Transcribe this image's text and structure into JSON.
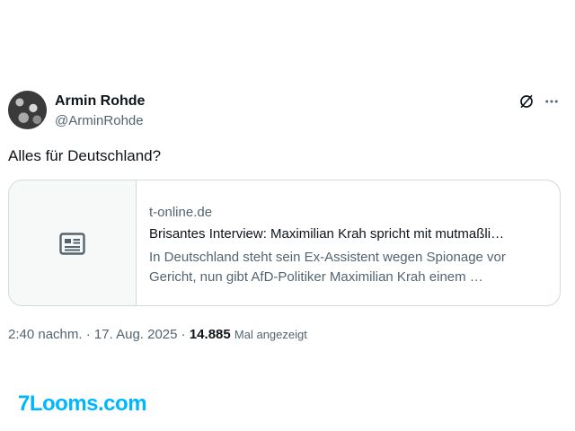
{
  "author": {
    "name": "Armin Rohde",
    "handle": "@ArminRohde"
  },
  "tweet": {
    "text": "Alles für Deutschland?"
  },
  "card": {
    "domain": "t-online.de",
    "title": "Brisantes Interview: Maximilian Krah spricht mit mutmaßli…",
    "description": "In Deutschland steht sein Ex-Assistent wegen Spionage vor Gericht, nun gibt AfD-Politiker Maximilian Krah einem …"
  },
  "meta": {
    "time": "2:40 nachm.",
    "date": "17. Aug. 2025",
    "views": "14.885",
    "views_label": "Mal angezeigt"
  },
  "watermark": "7Looms.com",
  "icons": {
    "grok": "grok-icon",
    "more": "more-icon",
    "card": "news-icon"
  },
  "colors": {
    "secondary_text": "#536471",
    "border": "#cfd9de",
    "watermark": "#00b7ff"
  }
}
